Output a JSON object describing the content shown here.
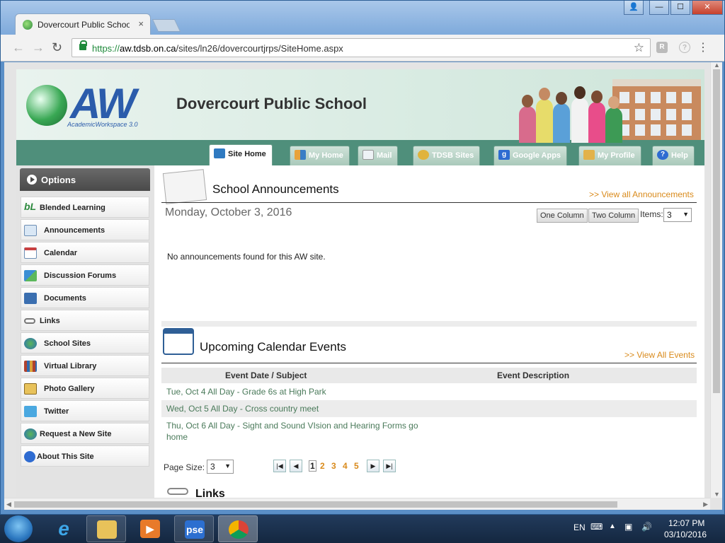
{
  "browser": {
    "tab_title": "Dovercourt Public Schoo",
    "tab_close": "×",
    "url_prefix": "https://",
    "url_host": "aw.tdsb.on.ca",
    "url_path": "/sites/ln26/dovercourtjrps/SiteHome.aspx",
    "back": "←",
    "forward": "→",
    "reload": "↻",
    "star": "☆",
    "ext1": "R",
    "ext2": "?",
    "menu": "⋮",
    "win_user": "👤",
    "win_min": "—",
    "win_max": "☐",
    "win_close": "✕"
  },
  "site": {
    "logo_text": "AW",
    "logo_subtitle": "AcademicWorkspace 3.0",
    "title": "Dovercourt Public School"
  },
  "nav_tabs": [
    {
      "label": "Site Home",
      "icon": "house-icon"
    },
    {
      "label": "My Home",
      "icon": "grid-icon"
    },
    {
      "label": "Mail",
      "icon": "envelope-icon"
    },
    {
      "label": "TDSB Sites",
      "icon": "magnifier-icon"
    },
    {
      "label": "Google Apps",
      "icon": "google-icon"
    },
    {
      "label": "My Profile",
      "icon": "profile-icon"
    },
    {
      "label": "Help",
      "icon": "help-icon"
    }
  ],
  "sidebar": {
    "header": "Options",
    "items": [
      {
        "label": "Blended Learning",
        "icon": "bl-icon"
      },
      {
        "label": "Announcements",
        "icon": "announcements-icon"
      },
      {
        "label": "Calendar",
        "icon": "calendar-icon"
      },
      {
        "label": "Discussion Forums",
        "icon": "forum-icon"
      },
      {
        "label": "Documents",
        "icon": "documents-icon"
      },
      {
        "label": "Links",
        "icon": "chain-link-icon"
      },
      {
        "label": "School Sites",
        "icon": "globe-icon"
      },
      {
        "label": "Virtual Library",
        "icon": "books-icon"
      },
      {
        "label": "Photo Gallery",
        "icon": "photo-icon"
      },
      {
        "label": "Twitter",
        "icon": "twitter-icon"
      },
      {
        "label": "Request a New Site",
        "icon": "globe-plus-icon"
      },
      {
        "label": "About This Site",
        "icon": "info-icon"
      }
    ]
  },
  "announcements": {
    "title": "School Announcements",
    "view_all": ">> View all Announcements",
    "date": "Monday, October 3, 2016",
    "one_column": "One Column",
    "two_column": "Two Column",
    "items_label": "Items:",
    "items_value": "3",
    "empty_message": "No announcements found for this AW site."
  },
  "events": {
    "title": "Upcoming Calendar Events",
    "view_all": ">> View All Events",
    "col_subject": "Event Date / Subject",
    "col_description": "Event Description",
    "rows": [
      {
        "subject": "Tue, Oct 4 All Day - Grade 6s at High Park",
        "description": ""
      },
      {
        "subject": "Wed, Oct 5 All Day - Cross country meet",
        "description": ""
      },
      {
        "subject": "Thu, Oct 6 All Day - Sight and Sound VIsion and Hearing Forms go home",
        "description": ""
      }
    ],
    "page_size_label": "Page Size:",
    "page_size_value": "3",
    "pages": [
      "1",
      "2",
      "3",
      "4",
      "5"
    ],
    "current_page": "1"
  },
  "links_section": {
    "title": "Links"
  },
  "taskbar": {
    "lang": "EN",
    "time": "12:07 PM",
    "date": "03/10/2016",
    "pse_label": "pse"
  },
  "colors": {
    "accent_green": "#4f8f7b",
    "link_orange": "#d98a1b",
    "aw_blue": "#2b5cab"
  }
}
